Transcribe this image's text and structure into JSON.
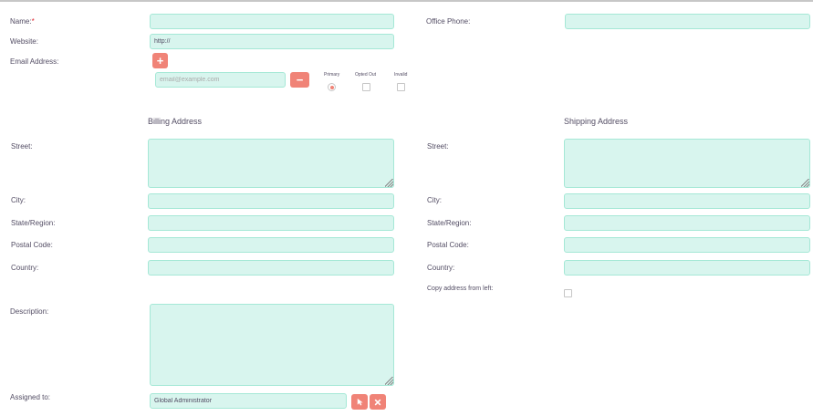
{
  "form": {
    "name_label": "Name:",
    "required_mark": "*",
    "name_value": "",
    "office_phone_label": "Office Phone:",
    "office_phone_value": "",
    "website_label": "Website:",
    "website_value": "http://",
    "email_label": "Email Address:",
    "add_email_icon": "+",
    "remove_email_icon": "−",
    "email_placeholder": "email@example.com",
    "email_value": "",
    "email_flags": {
      "primary": "Primary",
      "opted_out": "Opted Out",
      "invalid": "Invalid"
    },
    "primary_checked": true,
    "opted_out_checked": false,
    "invalid_checked": false
  },
  "billing": {
    "heading": "Billing Address",
    "street_label": "Street:",
    "city_label": "City:",
    "state_label": "State/Region:",
    "postal_label": "Postal Code:",
    "country_label": "Country:"
  },
  "shipping": {
    "heading": "Shipping Address",
    "street_label": "Street:",
    "city_label": "City:",
    "state_label": "State/Region:",
    "postal_label": "Postal Code:",
    "country_label": "Country:",
    "copy_label": "Copy address from left:",
    "copy_checked": false
  },
  "description": {
    "label": "Description:",
    "value": ""
  },
  "assigned": {
    "label": "Assigned to:",
    "value": "Global Administrator",
    "select_icon": "cursor-arrow-icon",
    "clear_icon": "close-x-icon"
  },
  "colors": {
    "field_bg": "#d8f5ee",
    "field_border": "#a5e8d6",
    "button": "#f08377",
    "required": "#e0262e",
    "text": "#534d64"
  }
}
